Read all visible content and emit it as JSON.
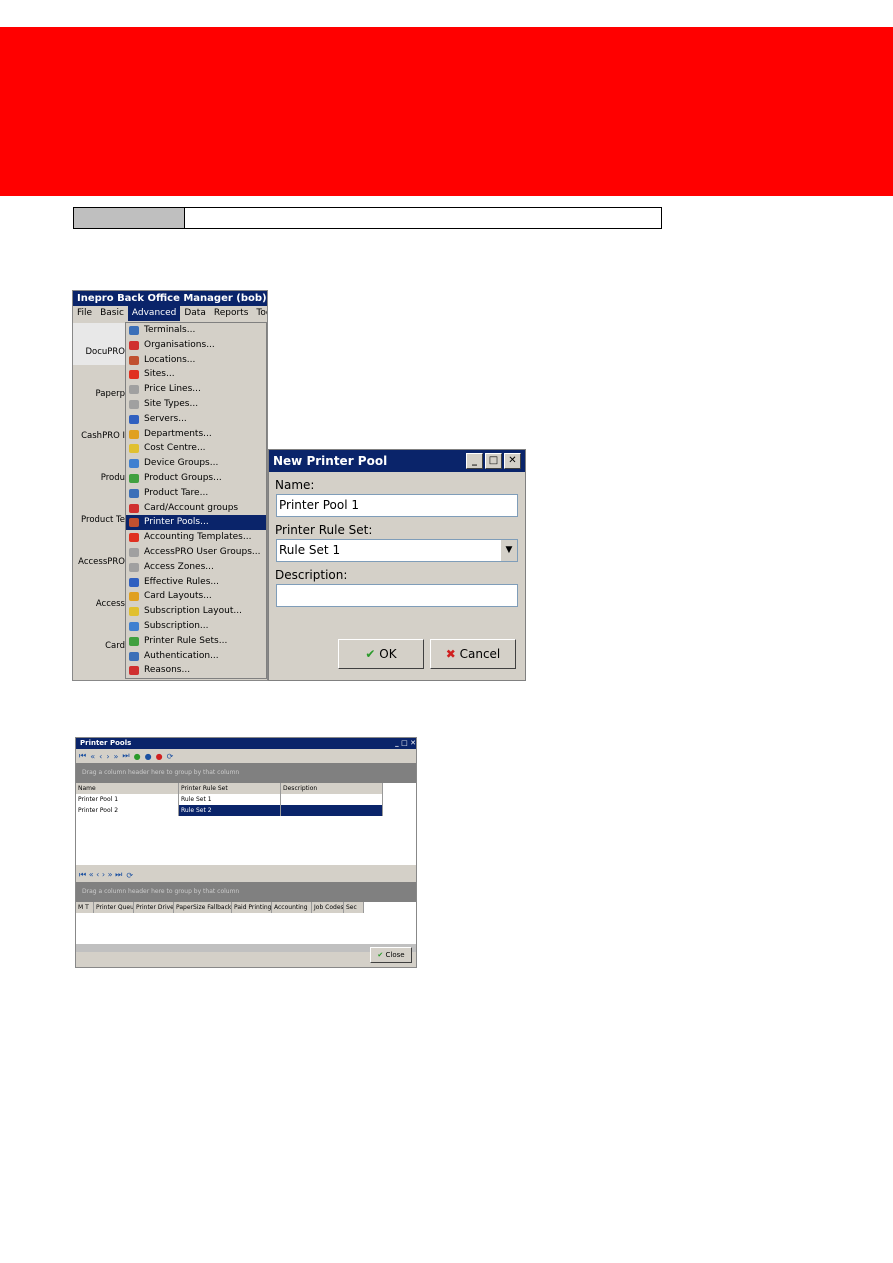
{
  "app": {
    "title": "Inepro Back Office Manager (bob)",
    "menu": [
      "File",
      "Basic",
      "Advanced",
      "Data",
      "Reports",
      "Tools"
    ],
    "active_menu": "Advanced",
    "sidebar": [
      "DocuPRO",
      "Paperp",
      "CashPRO I",
      "Produ",
      "Product Te",
      "AccessPRO",
      "Access",
      "Card",
      ""
    ],
    "advanced_items": [
      "Terminals...",
      "Organisations...",
      "Locations...",
      "Sites...",
      "Price Lines...",
      "Site Types...",
      "Servers...",
      "Departments...",
      "Cost Centre...",
      "Device Groups...",
      "Product Groups...",
      "Product Tare...",
      "Card/Account groups",
      "Printer Pools...",
      "Accounting Templates...",
      "AccessPRO User Groups...",
      "Access Zones...",
      "Effective Rules...",
      "Card Layouts...",
      "Subscription Layout...",
      "Subscription...",
      "Printer Rule Sets...",
      "Authentication...",
      "Reasons..."
    ],
    "highlighted_item": "Printer Pools..."
  },
  "dialog": {
    "title": "New Printer Pool",
    "name_label": "Name:",
    "name_value": "Printer Pool 1",
    "ruleset_label": "Printer Rule Set:",
    "ruleset_value": "Rule Set 1",
    "description_label": "Description:",
    "description_value": "",
    "ok": "OK",
    "cancel": "Cancel"
  },
  "pools": {
    "title": "Printer Pools",
    "group_hint": "Drag a column header here to group by that column",
    "columns": [
      "Name",
      "Printer Rule Set",
      "Description"
    ],
    "rows": [
      [
        "Printer Pool 1",
        "Rule Set 1",
        ""
      ],
      [
        "Printer Pool 2",
        "Rule Set 2",
        ""
      ]
    ],
    "group_hint2": "Drag a column header here to group by that column",
    "columns2": [
      "M T",
      "Printer Queue",
      "Printer Driver",
      "PaperSize Fallback",
      "Paid Printing",
      "Accounting",
      "Job Codes",
      "Sec"
    ],
    "close": "Close"
  }
}
